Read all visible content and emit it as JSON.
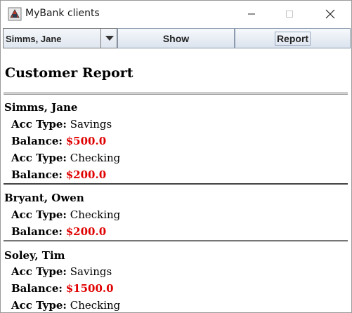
{
  "window": {
    "title": "MyBank clients"
  },
  "toolbar": {
    "selected_client": "Simms, Jane",
    "show_label": "Show",
    "report_label": "Report"
  },
  "report": {
    "heading": "Customer Report",
    "acc_type_label": "Acc Type:",
    "balance_label": "Balance:",
    "customers": [
      {
        "name": "Simms, Jane",
        "accounts": [
          {
            "type": "Savings",
            "balance": "$500.0"
          },
          {
            "type": "Checking",
            "balance": "$200.0"
          }
        ]
      },
      {
        "name": "Bryant, Owen",
        "accounts": [
          {
            "type": "Checking",
            "balance": "$200.0"
          }
        ]
      },
      {
        "name": "Soley, Tim",
        "accounts": [
          {
            "type": "Savings",
            "balance": "$1500.0"
          },
          {
            "type": "Checking"
          }
        ]
      }
    ]
  },
  "colors": {
    "balance": "#e00000"
  }
}
